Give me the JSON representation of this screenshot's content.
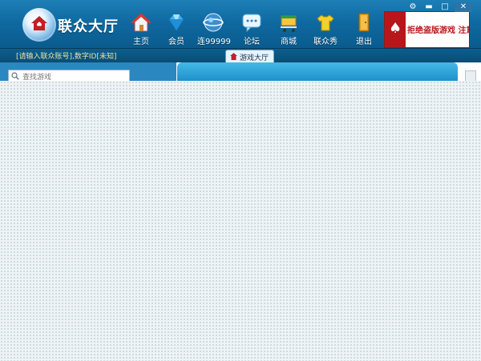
{
  "app": {
    "title": "联众大厅"
  },
  "nav": [
    {
      "label": "主页",
      "icon": "home-icon"
    },
    {
      "label": "会员",
      "icon": "diamond-icon"
    },
    {
      "label": "连99999",
      "icon": "globe-icon"
    },
    {
      "label": "论坛",
      "icon": "chat-bubble-icon"
    },
    {
      "label": "商城",
      "icon": "shop-cart-icon"
    },
    {
      "label": "联众秀",
      "icon": "tshirt-icon"
    },
    {
      "label": "退出",
      "icon": "exit-door-icon"
    }
  ],
  "ad": {
    "text": "拒绝盗版游戏 注意自我保护"
  },
  "status": {
    "text": "[请输入联众账号],数字ID[未知]"
  },
  "tab": {
    "label": "游戏大厅"
  },
  "search": {
    "placeholder": "查找游戏"
  },
  "colors": {
    "header": "#0f6aa1",
    "accent_red": "#b7171b",
    "loading_bg": "#eef3f6"
  }
}
